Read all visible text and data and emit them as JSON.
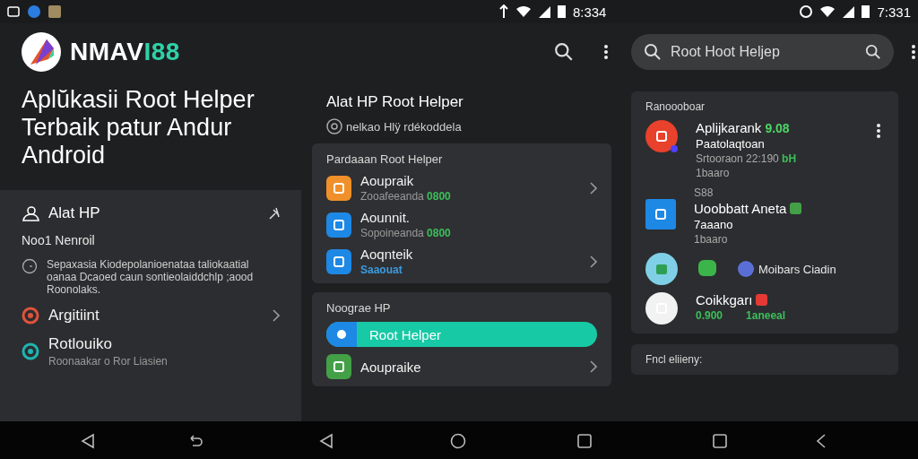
{
  "status_bar": {
    "times": [
      "8:334",
      "7:331"
    ]
  },
  "left": {
    "brand_main": "NMAV",
    "brand_accent": "I88",
    "title": "Aplŭkasii Root Helper Terbaik patur Andur Android",
    "panel": {
      "heading": "Alat HP",
      "section": "Noo1 Nenroil",
      "note": "Sepaxasia Kiodepolanioenataa taliokaatial oanaa Dcaoed caun sontieolaiddchlp ;aood Roonolaks.",
      "items": [
        {
          "title": "Argitiint",
          "color": "#e0533a",
          "chevron": true
        },
        {
          "title": "Rotlouiko",
          "subtitle": "Roonaakar o Ror Liasien",
          "color": "#1fb5b0",
          "chevron": false
        }
      ]
    }
  },
  "middle": {
    "title": "Alat HP Root Helper",
    "subtitle": "nelkao Hlÿ rdékoddela",
    "cards": [
      {
        "title": "Pardaaan Root Helper",
        "items": [
          {
            "kind": "app",
            "title": "Aoupraik",
            "subtitle": "Zooafeeanda",
            "value": "0800",
            "color": "#f0902a",
            "chevron": true
          },
          {
            "kind": "app",
            "title": "Aounnit.",
            "subtitle": "Sopoineanda",
            "value": "0800",
            "color": "#1e88e5",
            "chevron": false
          },
          {
            "kind": "app",
            "title": "Aoqnteik",
            "value": "Saaouat",
            "color": "#1e88e5",
            "chevron": true
          }
        ]
      },
      {
        "title": "Noograe HP",
        "items": [
          {
            "kind": "highlight",
            "title": "Root Helper",
            "color": "#1e88e5",
            "selected": true
          },
          {
            "kind": "app",
            "title": "Aoupraike",
            "color": "#43a047",
            "chevron": true
          }
        ]
      }
    ]
  },
  "right": {
    "search": {
      "value": "Root Hoot Heljep"
    },
    "cards": [
      {
        "title": "Ranoooboar",
        "rows": [
          {
            "kind": "app",
            "color": "#e8412c",
            "square": false,
            "title": "Aplijkarank",
            "badge": "9.08",
            "lines": [
              "Paatolaqtoan"
            ],
            "meta": "Srtooraon 22:190",
            "meta_accent": "bH",
            "foot": "1baaro",
            "menu": true
          },
          {
            "kind": "app",
            "color": "#1e88e5",
            "square": true,
            "label": "S88",
            "title": "Uoobbatt Aneta",
            "flag": {
              "color": "#43a047"
            },
            "lines": [
              "7aaano"
            ],
            "foot": "1baaro",
            "menu": false
          },
          {
            "kind": "icons",
            "caption": "Moibars Ciadin"
          },
          {
            "kind": "app",
            "color": "#f2f2f2",
            "square": false,
            "title": "Coikkgarı",
            "flag": {
              "color": "#e53935"
            },
            "stats": [
              "0.900",
              "1aneeal"
            ],
            "menu": false
          }
        ]
      },
      {
        "title": "Fncl eliieny:"
      }
    ]
  }
}
